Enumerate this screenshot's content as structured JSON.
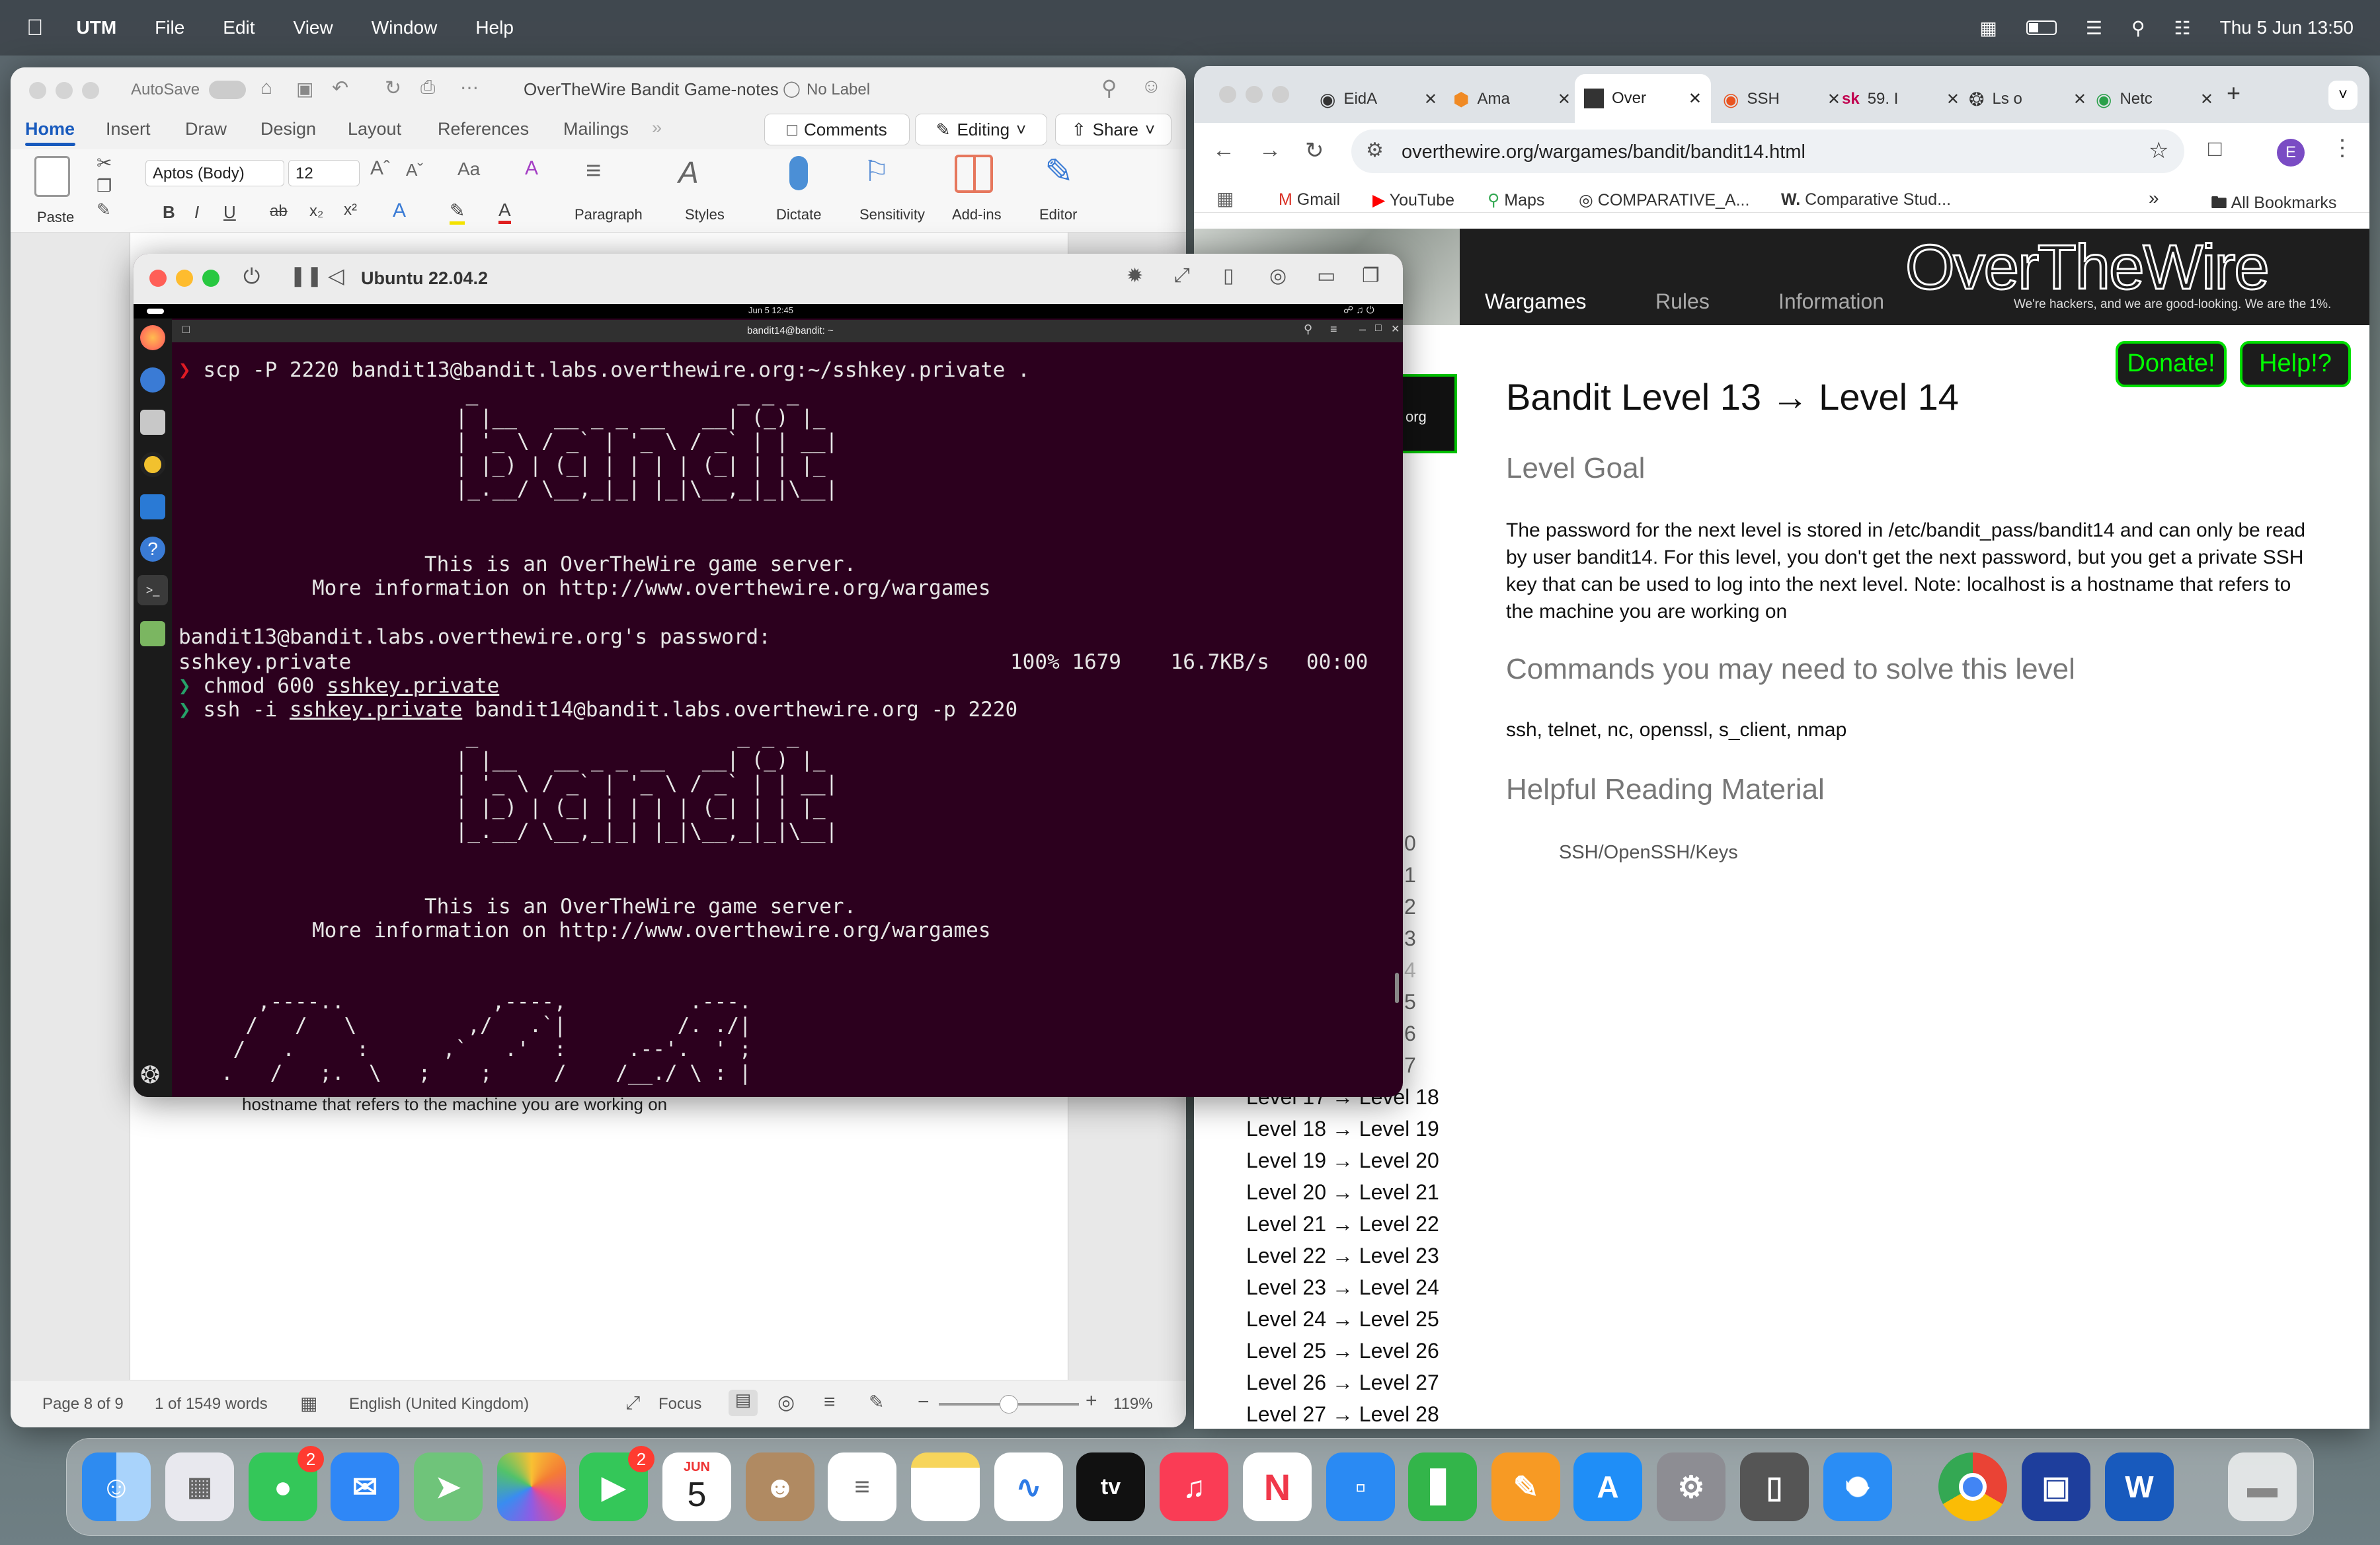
{
  "menubar": {
    "app": "UTM",
    "items": [
      "File",
      "Edit",
      "View",
      "Window",
      "Help"
    ],
    "datetime": "Thu 5 Jun  13:50"
  },
  "word": {
    "autosave": "AutoSave",
    "doc_title": "OverTheWire Bandit Game-notes",
    "label": "No Label",
    "tabs": [
      "Home",
      "Insert",
      "Draw",
      "Design",
      "Layout",
      "References",
      "Mailings"
    ],
    "comments": "Comments",
    "editing": "Editing",
    "share": "Share",
    "paste": "Paste",
    "font": "Aptos (Body)",
    "size": "12",
    "paragraph": "Paragraph",
    "styles": "Styles",
    "dictate": "Dictate",
    "sensitivity": "Sensitivity",
    "addins": "Add-ins",
    "editor": "Editor",
    "doc_text": "hostname that refers to the machine you are working on",
    "status": {
      "page": "Page 8 of 9",
      "words": "1 of 1549 words",
      "lang": "English (United Kingdom)",
      "focus": "Focus",
      "zoom": "119%"
    }
  },
  "utm": {
    "title": "Ubuntu 22.04.2",
    "topbar_time": "Jun 5  12:45",
    "term_title": "bandit14@bandit: ~"
  },
  "terminal": {
    "cmd1": "scp -P 2220 bandit13@bandit.labs.overthewire.org:~/sshkey.private .",
    "banner": [
      " _                     _ _ _   ",
      " | |__   __ _ _ __   __| (_) |_ ",
      " | '_ \\ / _` | '_ \\ / _` | | __|",
      " | |_) | (_| | | | | (_| | | |_ ",
      " |_.__/ \\__,_|_| |_|\\__,_|_|\\__|"
    ],
    "server1": "This is an OverTheWire game server.",
    "server2": "More information on http://www.overthewire.org/wargames",
    "pwprompt": "bandit13@bandit.labs.overthewire.org's password:",
    "xfer_file": "sshkey.private",
    "xfer_stats": "100% 1679    16.7KB/s   00:00",
    "cmd2_a": "chmod 600 ",
    "cmd2_b": "sshkey.private",
    "cmd3_a": "ssh -i ",
    "cmd3_b": "sshkey.private",
    "cmd3_c": " bandit14@bandit.labs.overthewire.org -p 2220",
    "art": [
      "      ,----..            ,----,          .---.",
      "     /   /   \\         ,/   .`|         /. ./|",
      "    /   .     :      ,`   .'  :     .--'.  ' ;",
      "   .   /   ;.  \\   ;    ;     /    /__./ \\ : |"
    ]
  },
  "chrome": {
    "tabs": [
      "EidA",
      "Ama",
      "Over",
      "SSH",
      "59. I",
      "Ls o",
      "Netc"
    ],
    "url": "overthewire.org/wargames/bandit/bandit14.html",
    "profile": "E",
    "bookmarks": [
      "Gmail",
      "YouTube",
      "Maps",
      "COMPARATIVE_A...",
      "Comparative Stud...",
      "All Bookmarks"
    ]
  },
  "otw": {
    "nav": [
      "Wargames",
      "Rules",
      "Information"
    ],
    "logo": "OverTheWire",
    "tagline": "We're hackers, and we are good-looking. We are the 1%.",
    "donate": "Donate!",
    "help": "Help!?",
    "side_frag": "org",
    "title": "Bandit Level 13 → Level 14",
    "goal_h": "Level Goal",
    "goal": "The password for the next level is stored in /etc/bandit_pass/bandit14 and can only be read by user bandit14. For this level, you don't get the next password, but you get a private SSH key that can be used to log into the next level. Note: localhost is a hostname that refers to the machine you are working on",
    "cmds_h": "Commands you may need to solve this level",
    "cmds": "ssh, telnet, nc, openssl, s_client, nmap",
    "read_h": "Helpful Reading Material",
    "read_link": "SSH/OpenSSH/Keys",
    "frag_nums": [
      "0",
      "1",
      "2",
      "3",
      "4",
      "5",
      "6",
      "7"
    ],
    "levels": [
      "Level 17 → Level 18",
      "Level 18 → Level 19",
      "Level 19 → Level 20",
      "Level 20 → Level 21",
      "Level 21 → Level 22",
      "Level 22 → Level 23",
      "Level 23 → Level 24",
      "Level 24 → Level 25",
      "Level 25 → Level 26",
      "Level 26 → Level 27",
      "Level 27 → Level 28"
    ]
  },
  "dock": {
    "facetime_badge": "2",
    "messages_badge": "2",
    "cal_month": "JUN",
    "cal_day": "5",
    "tv": "tv"
  }
}
